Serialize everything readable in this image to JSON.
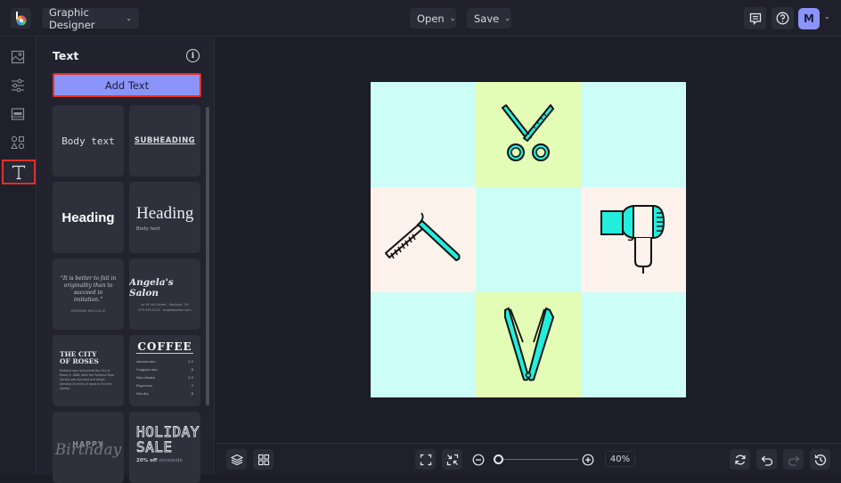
{
  "app": {
    "title_dropdown": "Graphic Designer",
    "open_label": "Open",
    "save_label": "Save",
    "avatar_initial": "M",
    "accent_color": "#8b94f9",
    "highlight_color": "#e0302a"
  },
  "rail": {
    "items": [
      {
        "name": "image",
        "active": false
      },
      {
        "name": "adjustments",
        "active": false
      },
      {
        "name": "layout",
        "active": false
      },
      {
        "name": "shapes",
        "active": false
      },
      {
        "name": "text",
        "active": true
      }
    ]
  },
  "panel": {
    "title": "Text",
    "add_text_label": "Add Text",
    "presets": {
      "body_text": "Body text",
      "subheading": "SUBHEADING",
      "heading_bold": "Heading",
      "heading_serif": "Heading",
      "heading_serif_sub": "Body text",
      "quote": "“It is better to fail in originality than to succeed in imitation.”",
      "quote_author": "HERMAN MELVILLE",
      "salon_title": "Angela's Salon",
      "salon_line1": "xx SE 9th Street · Portland, OR",
      "salon_line2": "503.555.5724 · angelassalon.com",
      "city_title": "THE CITY OF ROSES",
      "city_body": "Portland was nicknamed the City of Roses in 1888, after the Portland Rose Society was founded and began planting 20 miles of roses to line the streets.",
      "coffee_title": "COFFEE",
      "coffee_menu": [
        {
          "item": "Americano",
          "price": "3.5"
        },
        {
          "item": "Cappuccino",
          "price": "4"
        },
        {
          "item": "Macchiato",
          "price": "3.5"
        },
        {
          "item": "Espresso",
          "price": "3"
        },
        {
          "item": "Mocha",
          "price": "4"
        }
      ],
      "birthday_top": "HAPPY",
      "birthday_script": "Birthday",
      "holiday_title_1": "HOLIDAY",
      "holiday_title_2": "SALE",
      "holiday_sub_bold": "20% off",
      "holiday_sub": "storewide"
    }
  },
  "canvas": {
    "cells": [
      {
        "bg": "#ccfdf7",
        "icon": "none"
      },
      {
        "bg": "#e3fdb6",
        "icon": "scissors"
      },
      {
        "bg": "#ccfdf7",
        "icon": "none"
      },
      {
        "bg": "#fef2ec",
        "icon": "straight-razor"
      },
      {
        "bg": "#ccfdf7",
        "icon": "none"
      },
      {
        "bg": "#fef2ec",
        "icon": "hair-dryer"
      },
      {
        "bg": "#ccfdf7",
        "icon": "none"
      },
      {
        "bg": "#e3fdb6",
        "icon": "hair-straightener"
      },
      {
        "bg": "#ccfdf7",
        "icon": "none"
      }
    ],
    "icon_fill": "#22eedd"
  },
  "bottombar": {
    "zoom_value": "40%",
    "zoom_level_fraction": 0.0
  }
}
